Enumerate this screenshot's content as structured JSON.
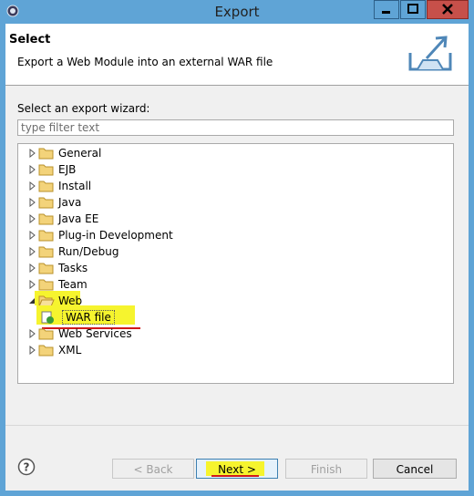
{
  "window": {
    "title": "Export"
  },
  "header": {
    "title": "Select",
    "description": "Export a Web Module into an external WAR file"
  },
  "wizard": {
    "label": "Select an export wizard:",
    "filter_placeholder": "type filter text",
    "tree": [
      {
        "label": "General",
        "expanded": false
      },
      {
        "label": "EJB",
        "expanded": false
      },
      {
        "label": "Install",
        "expanded": false
      },
      {
        "label": "Java",
        "expanded": false
      },
      {
        "label": "Java EE",
        "expanded": false
      },
      {
        "label": "Plug-in Development",
        "expanded": false
      },
      {
        "label": "Run/Debug",
        "expanded": false
      },
      {
        "label": "Tasks",
        "expanded": false
      },
      {
        "label": "Team",
        "expanded": false
      },
      {
        "label": "Web",
        "expanded": true,
        "highlighted": true,
        "children": [
          {
            "label": "WAR file",
            "selected": true,
            "highlighted": true
          }
        ]
      },
      {
        "label": "Web Services",
        "expanded": false
      },
      {
        "label": "XML",
        "expanded": false
      }
    ]
  },
  "buttons": {
    "back": "< Back",
    "next": "Next >",
    "finish": "Finish",
    "cancel": "Cancel"
  },
  "colors": {
    "titlebar": "#5fa4d6",
    "highlight": "#f6f42e",
    "annotation_red": "#d01a1a",
    "close_button": "#c7504a"
  }
}
